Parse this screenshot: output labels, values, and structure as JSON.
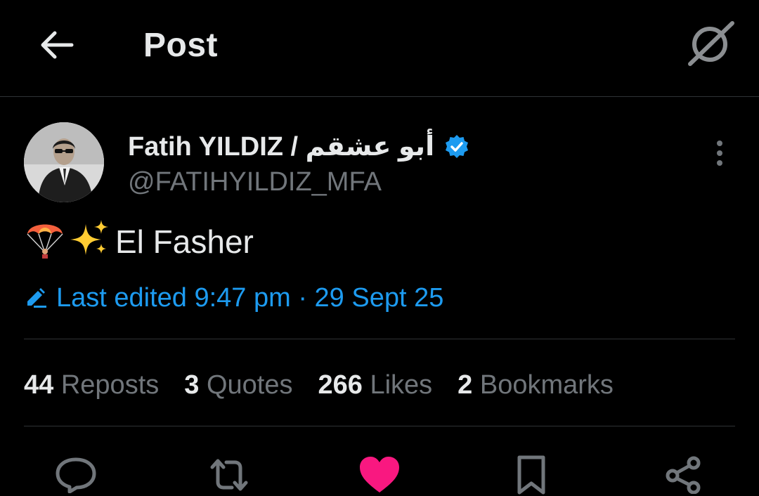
{
  "header": {
    "title": "Post",
    "back_icon": "arrow-left-icon",
    "grok_icon": "grok-icon"
  },
  "author": {
    "name": "Fatih YILDIZ / أبو عشقم",
    "handle": "@FATIHYILDIZ_MFA",
    "verified": true,
    "verified_color": "#1d9bf0"
  },
  "post": {
    "emojis": [
      "🪂",
      "✨"
    ],
    "text": "El Fasher",
    "edited_text": "Last edited 9:47 pm · 29 Sept 25"
  },
  "stats": [
    {
      "count": "44",
      "label": "Reposts"
    },
    {
      "count": "3",
      "label": "Quotes"
    },
    {
      "count": "266",
      "label": "Likes"
    },
    {
      "count": "2",
      "label": "Bookmarks"
    }
  ],
  "actions": {
    "reply_icon": "reply-icon",
    "repost_icon": "repost-icon",
    "like_icon": "heart-icon",
    "like_active": true,
    "like_color": "#f91880",
    "bookmark_icon": "bookmark-icon",
    "share_icon": "share-icon"
  },
  "colors": {
    "background": "#000000",
    "text_primary": "#e7e9ea",
    "text_secondary": "#71767b",
    "accent": "#1d9bf0",
    "divider": "#2f3336"
  }
}
